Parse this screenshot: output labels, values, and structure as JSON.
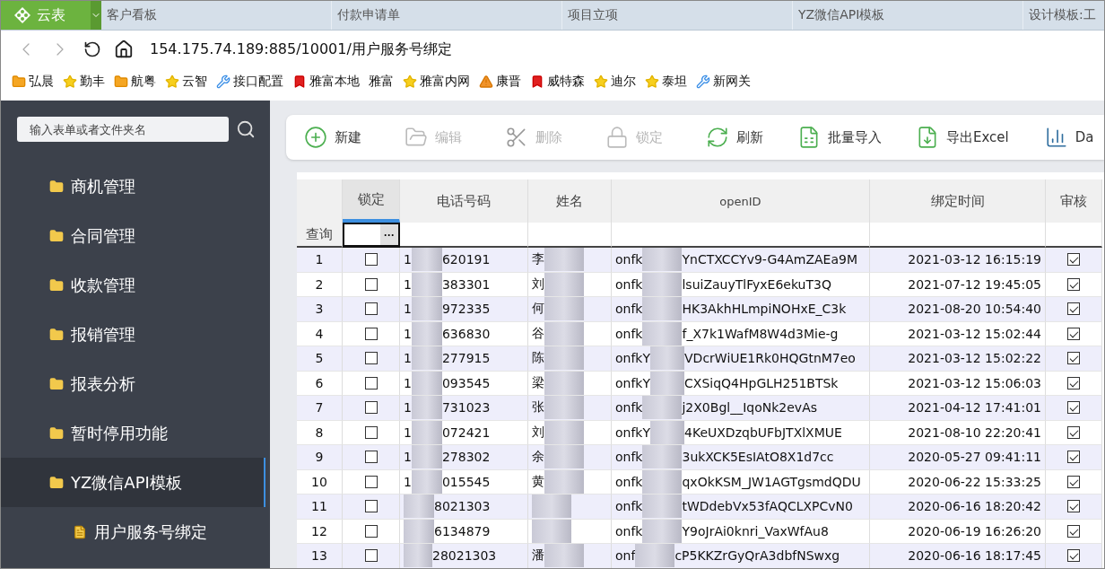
{
  "tabs": [
    {
      "label": "客户看板",
      "selected": false
    },
    {
      "label": "付款申请单",
      "selected": false
    },
    {
      "label": "项目立项",
      "selected": false
    },
    {
      "label": "YZ微信API模板",
      "selected": false
    },
    {
      "label": "设计模板:工",
      "selected": false
    }
  ],
  "app_button": {
    "label": "云表"
  },
  "address": "154.175.74.189:885/10001/用户服务号绑定",
  "bookmarks": [
    {
      "kind": "folder",
      "label": "弘晨"
    },
    {
      "kind": "star",
      "label": "勤丰"
    },
    {
      "kind": "folder",
      "label": "航粤"
    },
    {
      "kind": "star",
      "label": "云智"
    },
    {
      "kind": "wrench",
      "label": "接口配置"
    },
    {
      "kind": "flag",
      "label": "雅富本地"
    },
    {
      "kind": "plain",
      "label": "雅富"
    },
    {
      "kind": "star",
      "label": "雅富内网"
    },
    {
      "kind": "warning",
      "label": "康晋"
    },
    {
      "kind": "flag",
      "label": "威特森"
    },
    {
      "kind": "star",
      "label": "迪尔"
    },
    {
      "kind": "star",
      "label": "泰坦"
    },
    {
      "kind": "wrench",
      "label": "新网关"
    }
  ],
  "sidebar": {
    "search_placeholder": "输入表单或者文件夹名",
    "items": [
      {
        "label": "商机管理",
        "selected": false
      },
      {
        "label": "合同管理",
        "selected": false
      },
      {
        "label": "收款管理",
        "selected": false
      },
      {
        "label": "报销管理",
        "selected": false
      },
      {
        "label": "报表分析",
        "selected": false
      },
      {
        "label": "暂时停用功能",
        "selected": false
      },
      {
        "label": "YZ微信API模板",
        "selected": true,
        "children": [
          {
            "label": "用户服务号绑定"
          }
        ]
      }
    ]
  },
  "toolbar": [
    {
      "kind": "add",
      "label": "新建",
      "disabled": false
    },
    {
      "kind": "edit",
      "label": "编辑",
      "disabled": true
    },
    {
      "kind": "delete",
      "label": "删除",
      "disabled": true
    },
    {
      "kind": "lock",
      "label": "锁定",
      "disabled": true
    },
    {
      "kind": "refresh",
      "label": "刷新",
      "disabled": false
    },
    {
      "kind": "import",
      "label": "批量导入",
      "disabled": false
    },
    {
      "kind": "export",
      "label": "导出Excel",
      "disabled": false
    },
    {
      "kind": "chart",
      "label": "Da",
      "disabled": false
    }
  ],
  "table": {
    "columns": [
      "锁定",
      "电话号码",
      "姓名",
      "openID",
      "绑定时间",
      "审核"
    ],
    "filter_label": "查询",
    "filter_button": "···",
    "rows": [
      {
        "no": "1",
        "locked": false,
        "phone_lead": "1",
        "phone": "620191",
        "name": "李",
        "openid_prefix": "onfk",
        "openid": "YnCTXCCYv9-G4AmZAEa9M",
        "time": "2021-03-12 16:15:19",
        "approved": true
      },
      {
        "no": "2",
        "locked": false,
        "phone_lead": "1",
        "phone": "383301",
        "name": "刘",
        "openid_prefix": "onfk",
        "openid": "lsuiZauyTlFyxE6ekuT3Q",
        "time": "2021-07-12 19:45:05",
        "approved": true
      },
      {
        "no": "3",
        "locked": false,
        "phone_lead": "1",
        "phone": "972335",
        "name": "何",
        "openid_prefix": "onfk",
        "openid": "HK3AkhHLmpiNOHxE_C3k",
        "time": "2021-08-20 10:54:40",
        "approved": true
      },
      {
        "no": "4",
        "locked": false,
        "phone_lead": "1",
        "phone": "636830",
        "name": "谷",
        "openid_prefix": "onfk",
        "openid": "f_X7k1WafM8W4d3Mie-g",
        "time": "2021-03-12 15:02:44",
        "approved": true
      },
      {
        "no": "5",
        "locked": false,
        "phone_lead": "1",
        "phone": "277915",
        "name": "陈",
        "openid_prefix": "onfkY",
        "openid": "VDcrWiUE1Rk0HQGtnM7eo",
        "time": "2021-03-12 15:02:22",
        "approved": true
      },
      {
        "no": "6",
        "locked": false,
        "phone_lead": "1",
        "phone": "093545",
        "name": "梁",
        "openid_prefix": "onfkY",
        "openid": "CXSiqQ4HpGLH251BTSk",
        "time": "2021-03-12 15:06:03",
        "approved": true
      },
      {
        "no": "7",
        "locked": false,
        "phone_lead": "1",
        "phone": "731023",
        "name": "张",
        "openid_prefix": "onfk",
        "openid": "j2X0Bgl__IqoNk2evAs",
        "time": "2021-04-12 17:41:01",
        "approved": true
      },
      {
        "no": "8",
        "locked": false,
        "phone_lead": "1",
        "phone": "072421",
        "name": "刘",
        "openid_prefix": "onfkY",
        "openid": "4KeUXDzqbUFbJTXlXMUE",
        "time": "2021-08-10 22:20:41",
        "approved": true
      },
      {
        "no": "9",
        "locked": false,
        "phone_lead": "1",
        "phone": "278302",
        "name": "余",
        "openid_prefix": "onfk",
        "openid": "3ukXCK5EsIAtO8X1d7cc",
        "time": "2020-05-27 09:41:11",
        "approved": true
      },
      {
        "no": "10",
        "locked": false,
        "phone_lead": "1",
        "phone": "015545",
        "name": "黄",
        "openid_prefix": "onfk",
        "openid": "qxOkKSM_JW1AGTgsmdQDU",
        "time": "2020-06-22 15:33:25",
        "approved": true
      },
      {
        "no": "11",
        "locked": false,
        "phone_lead": "",
        "phone": "8021303",
        "name": "",
        "openid_prefix": "onfk",
        "openid": "tWDdebVx53fAQCLXPCvN0",
        "time": "2020-06-16 18:20:42",
        "approved": true
      },
      {
        "no": "12",
        "locked": false,
        "phone_lead": "",
        "phone": "6134879",
        "name": "",
        "openid_prefix": "onfk",
        "openid": "Y9oJrAi0knri_VaxWfAu8",
        "time": "2020-06-19 16:26:20",
        "approved": true
      },
      {
        "no": "13",
        "locked": false,
        "phone_lead": "",
        "phone": "28021303",
        "name": "潘",
        "openid_prefix": "onf",
        "openid": "cP5KKZrGyQrA3dbfNSwxg",
        "time": "2020-06-16 18:17:45",
        "approved": true
      }
    ]
  }
}
